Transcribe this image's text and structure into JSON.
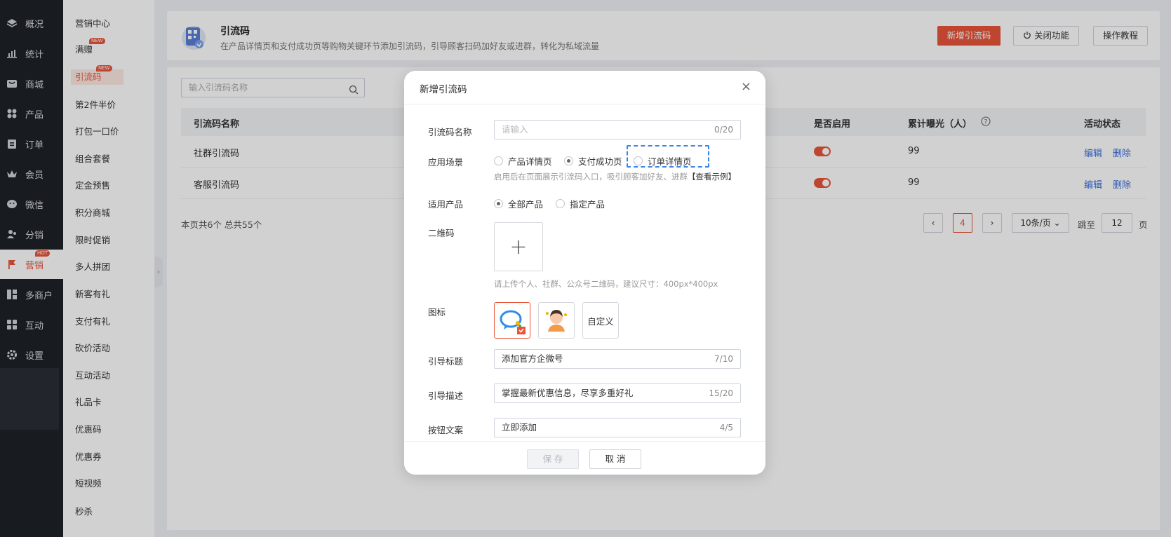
{
  "sidebar1": {
    "items": [
      {
        "label": "概况",
        "icon": "layers-icon"
      },
      {
        "label": "统计",
        "icon": "chart-icon"
      },
      {
        "label": "商城",
        "icon": "shop-icon"
      },
      {
        "label": "产品",
        "icon": "grid-icon"
      },
      {
        "label": "订单",
        "icon": "order-icon"
      },
      {
        "label": "会员",
        "icon": "crown-icon"
      },
      {
        "label": "微信",
        "icon": "wechat-icon"
      },
      {
        "label": "分销",
        "icon": "users-icon"
      },
      {
        "label": "营销",
        "icon": "flag-icon",
        "badge": "HOT"
      },
      {
        "label": "多商户",
        "icon": "merchant-icon"
      },
      {
        "label": "互动",
        "icon": "apps-icon"
      },
      {
        "label": "设置",
        "icon": "gear-icon"
      }
    ]
  },
  "sidebar2": {
    "items": [
      {
        "label": "营销中心"
      },
      {
        "label": "满赠",
        "badge": "NEW"
      },
      {
        "label": "引流码",
        "badge": "NEW"
      },
      {
        "label": "第2件半价"
      },
      {
        "label": "打包一口价"
      },
      {
        "label": "组合套餐"
      },
      {
        "label": "定金预售"
      },
      {
        "label": "积分商城"
      },
      {
        "label": "限时促销"
      },
      {
        "label": "多人拼团"
      },
      {
        "label": "新客有礼"
      },
      {
        "label": "支付有礼"
      },
      {
        "label": "砍价活动"
      },
      {
        "label": "互动活动"
      },
      {
        "label": "礼品卡"
      },
      {
        "label": "优惠码"
      },
      {
        "label": "优惠券"
      },
      {
        "label": "短视频"
      },
      {
        "label": "秒杀"
      }
    ]
  },
  "header": {
    "title": "引流码",
    "description": "在产品详情页和支付成功页等购物关键环节添加引流码，引导顾客扫码加好友或进群，转化为私域流量",
    "btn_add": "新增引流码",
    "btn_close": "关闭功能",
    "btn_tutorial": "操作教程"
  },
  "list": {
    "search_placeholder": "输入引流码名称",
    "columns": {
      "name": "引流码名称",
      "enabled": "是否启用",
      "exposure": "累计曝光（人）",
      "status": "活动状态"
    },
    "rows": [
      {
        "name": "社群引流码",
        "exposure": "99",
        "edit": "编辑",
        "delete": "删除"
      },
      {
        "name": "客服引流码",
        "exposure": "99",
        "edit": "编辑",
        "delete": "删除"
      }
    ],
    "summary": "本页共6个  总共55个",
    "pagination": {
      "current": "4",
      "page_size": "10条/页",
      "goto_label": "跳至",
      "goto_value": "12",
      "page_unit": "页"
    }
  },
  "modal": {
    "title": "新增引流码",
    "name_label": "引流码名称",
    "name_placeholder": "请输入",
    "name_count": "0/20",
    "scene_label": "应用场景",
    "scene_options": [
      "产品详情页",
      "支付成功页",
      "订单详情页"
    ],
    "scene_hint": "启用后在页面展示引流码入口，吸引顾客加好友、进群",
    "scene_hint_link": "【查看示例】",
    "product_label": "适用产品",
    "product_options": [
      "全部产品",
      "指定产品"
    ],
    "qr_label": "二维码",
    "qr_hint": "请上传个人、社群、公众号二维码，建议尺寸：400px*400px",
    "icon_label": "图标",
    "icon_custom": "自定义",
    "guide_title_label": "引导标题",
    "guide_title_value": "添加官方企微号",
    "guide_title_count": "7/10",
    "guide_desc_label": "引导描述",
    "guide_desc_value": "掌握最新优惠信息，尽享多重好礼",
    "guide_desc_count": "15/20",
    "btn_text_label": "按钮文案",
    "btn_text_value": "立即添加",
    "btn_text_count": "4/5",
    "save": "保 存",
    "cancel": "取 消"
  },
  "colors": {
    "accent": "#e8553a",
    "link": "#3a6ed8",
    "sidebar_bg": "#1e2128"
  }
}
